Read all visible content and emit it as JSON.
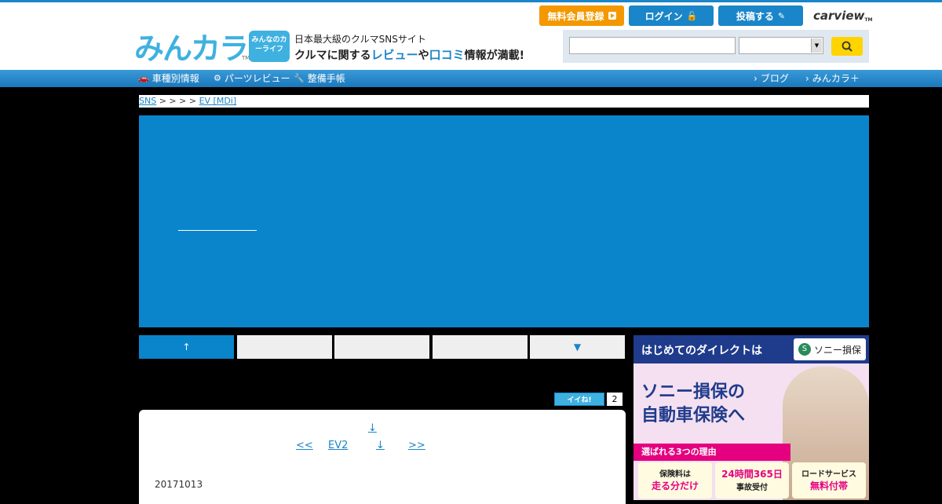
{
  "header": {
    "logo_text": "みんカラ",
    "logo_tm": "TM",
    "car_badge": "みんなのカーライフ",
    "tagline1": "日本最大級のクルマSNSサイト",
    "tagline2_pre": "クルマに関する",
    "tagline2_hl1": "レビュー",
    "tagline2_mid": "や",
    "tagline2_hl2": "口コミ",
    "tagline2_post": "情報が満載!",
    "buttons": {
      "register": "無料会員登録",
      "login": "ログイン",
      "post": "投稿する"
    },
    "carview": "carview",
    "carview_tm": "TM"
  },
  "nav": {
    "left": [
      "車種別情報",
      "パーツレビュー",
      "整備手帳"
    ],
    "right": [
      "ブログ",
      "みんカラ＋"
    ]
  },
  "breadcrumb": {
    "first": "SNS",
    "separators": "> > > >",
    "last": "EV [MDi]"
  },
  "tabs": [
    "↑",
    "",
    "",
    "",
    "▼"
  ],
  "iine": {
    "label": "イイね!",
    "count": "2"
  },
  "content": {
    "top_link": "↓",
    "prev": "<<",
    "mid": "EV2",
    "down": "↓",
    "next": ">>",
    "date": "20171013"
  },
  "ad": {
    "top": "はじめてのダイレクトは",
    "brand": "ソニー損保",
    "head1": "ソニー損保の",
    "head2": "自動車保険へ",
    "reason": "選ばれる3つの理由",
    "box1_a": "保険料は",
    "box1_b": "走る分だけ",
    "box2_a": "24時間365日",
    "box2_b": "事故受付",
    "box3_a": "ロードサービス",
    "box3_b": "無料付帯"
  },
  "colors": {
    "brand_blue": "#1a85c8",
    "panel_blue": "#0a85cc",
    "register_orange": "#f39800"
  }
}
